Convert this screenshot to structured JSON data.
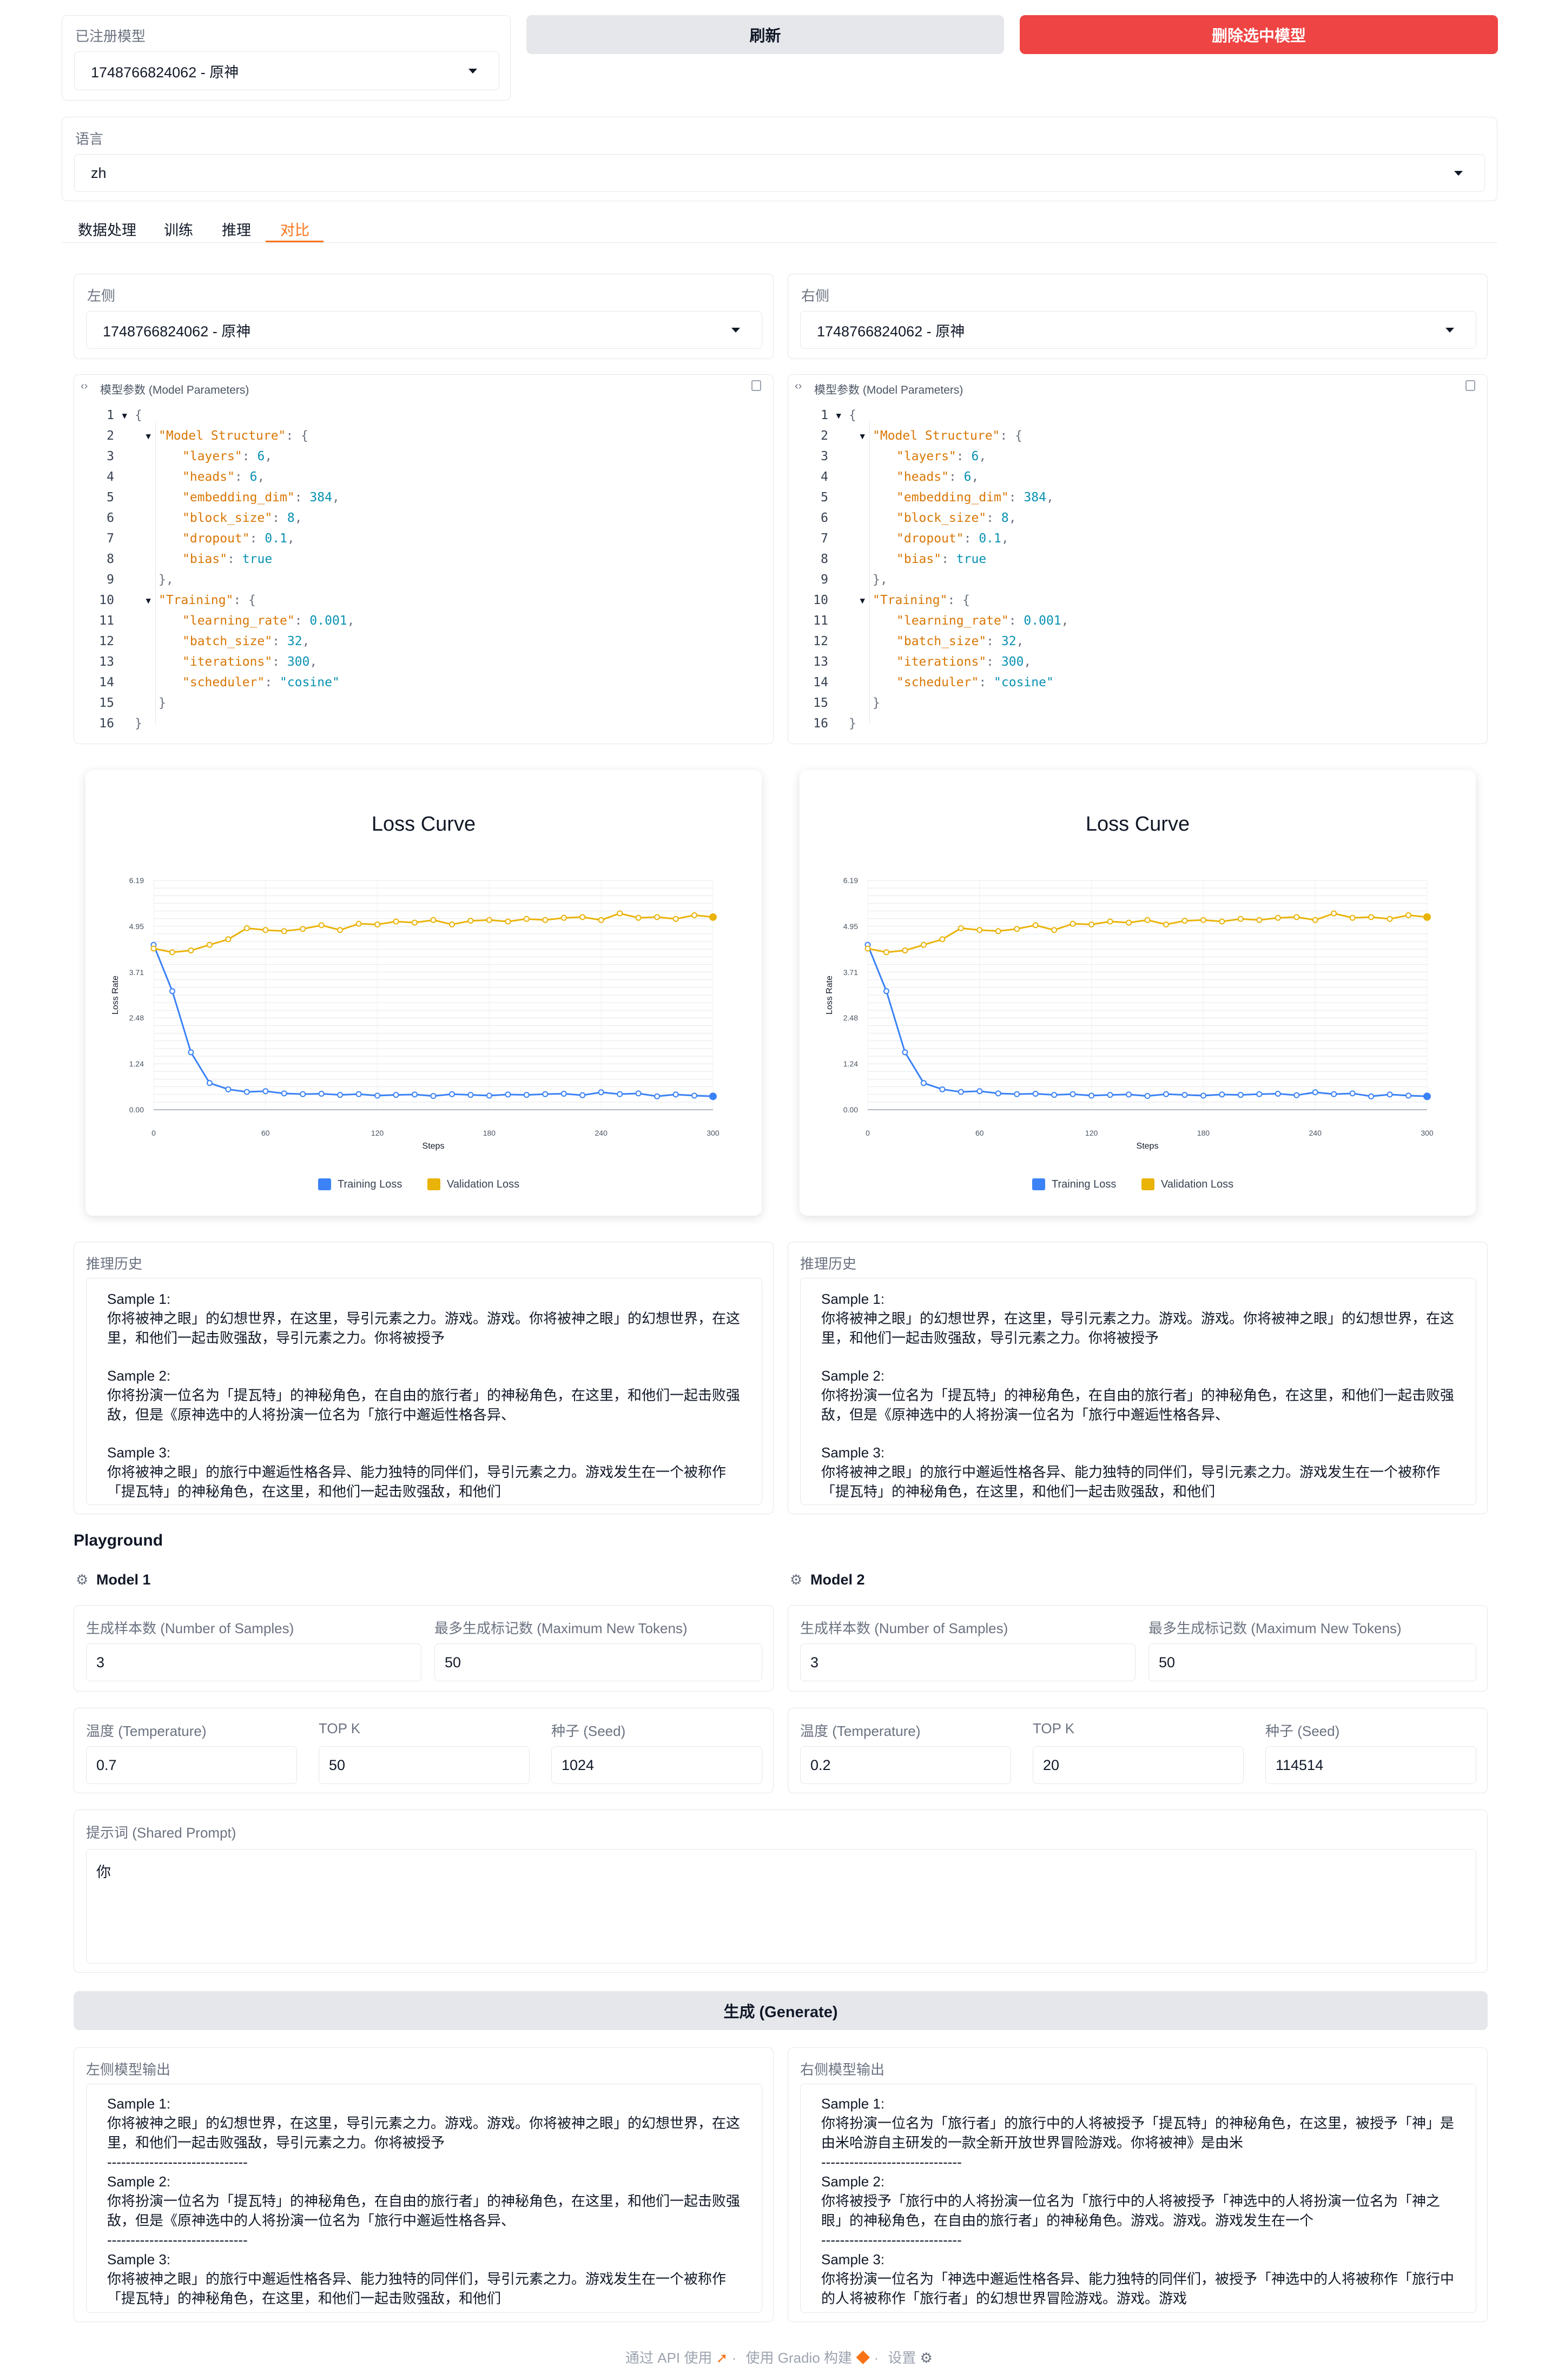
{
  "top": {
    "registered_models_label": "已注册模型",
    "registered_model_value": "1748766824062 - 原神",
    "refresh_label": "刷新",
    "delete_label": "删除选中模型",
    "delete_color": "#ef4444",
    "language_label": "语言",
    "language_value": "zh"
  },
  "tabs": [
    "数据处理",
    "训练",
    "推理",
    "对比"
  ],
  "active_tab": "对比",
  "accent_color": "#f97316",
  "compare": {
    "left_label": "左侧",
    "right_label": "右侧",
    "left_model": "1748766824062 - 原神",
    "right_model": "1748766824062 - 原神",
    "params_label": "模型参数 (Model Parameters)",
    "json_lines": [
      "{",
      "\"Model Structure\": {",
      "\"layers\": 6,",
      "\"heads\": 6,",
      "\"embedding_dim\": 384,",
      "\"block_size\": 8,",
      "\"dropout\": 0.1,",
      "\"bias\": true",
      "},",
      "\"Training\": {",
      "\"learning_rate\": 0.001,",
      "\"batch_size\": 32,",
      "\"iterations\": 300,",
      "\"scheduler\": \"cosine\"",
      "}",
      "}"
    ],
    "line_numbers": [
      "1",
      "2",
      "3",
      "4",
      "5",
      "6",
      "7",
      "8",
      "9",
      "10",
      "11",
      "12",
      "13",
      "14",
      "15",
      "16"
    ]
  },
  "chart_data": [
    {
      "type": "line",
      "title": "Loss Curve",
      "xlabel": "Steps",
      "ylabel": "Loss Rate",
      "xlim": [
        0,
        300
      ],
      "ylim": [
        0,
        6.19
      ],
      "x_ticks": [
        "0",
        "60",
        "120",
        "180",
        "240",
        "300"
      ],
      "y_ticks": [
        "0.00",
        "1.24",
        "2.48",
        "3.71",
        "4.95",
        "6.19"
      ],
      "grid": true,
      "legend_position": "bottom",
      "x": [
        0,
        10,
        20,
        30,
        40,
        50,
        60,
        70,
        80,
        90,
        100,
        110,
        120,
        130,
        140,
        150,
        160,
        170,
        180,
        190,
        200,
        210,
        220,
        230,
        240,
        250,
        260,
        270,
        280,
        290,
        300
      ],
      "series": [
        {
          "name": "Training Loss",
          "color": "#3b82f6",
          "values": [
            4.45,
            3.2,
            1.55,
            0.72,
            0.55,
            0.48,
            0.5,
            0.44,
            0.42,
            0.43,
            0.4,
            0.42,
            0.38,
            0.4,
            0.41,
            0.37,
            0.42,
            0.4,
            0.38,
            0.41,
            0.4,
            0.42,
            0.43,
            0.39,
            0.47,
            0.42,
            0.44,
            0.36,
            0.41,
            0.38,
            0.36
          ]
        },
        {
          "name": "Validation Loss",
          "color": "#eab308",
          "values": [
            4.35,
            4.25,
            4.3,
            4.45,
            4.6,
            4.9,
            4.85,
            4.82,
            4.88,
            4.98,
            4.85,
            5.02,
            5.0,
            5.08,
            5.05,
            5.12,
            5.0,
            5.1,
            5.12,
            5.08,
            5.15,
            5.12,
            5.18,
            5.2,
            5.12,
            5.3,
            5.18,
            5.2,
            5.15,
            5.25,
            5.2
          ]
        }
      ]
    },
    {
      "type": "line",
      "title": "Loss Curve",
      "xlabel": "Steps",
      "ylabel": "Loss Rate",
      "xlim": [
        0,
        300
      ],
      "ylim": [
        0,
        6.19
      ],
      "x_ticks": [
        "0",
        "60",
        "120",
        "180",
        "240",
        "300"
      ],
      "y_ticks": [
        "0.00",
        "1.24",
        "2.48",
        "3.71",
        "4.95",
        "6.19"
      ],
      "grid": true,
      "legend_position": "bottom",
      "x": [
        0,
        10,
        20,
        30,
        40,
        50,
        60,
        70,
        80,
        90,
        100,
        110,
        120,
        130,
        140,
        150,
        160,
        170,
        180,
        190,
        200,
        210,
        220,
        230,
        240,
        250,
        260,
        270,
        280,
        290,
        300
      ],
      "series": [
        {
          "name": "Training Loss",
          "color": "#3b82f6",
          "values": [
            4.45,
            3.2,
            1.55,
            0.72,
            0.55,
            0.48,
            0.5,
            0.44,
            0.42,
            0.43,
            0.4,
            0.42,
            0.38,
            0.4,
            0.41,
            0.37,
            0.42,
            0.4,
            0.38,
            0.41,
            0.4,
            0.42,
            0.43,
            0.39,
            0.47,
            0.42,
            0.44,
            0.36,
            0.41,
            0.38,
            0.36
          ]
        },
        {
          "name": "Validation Loss",
          "color": "#eab308",
          "values": [
            4.35,
            4.25,
            4.3,
            4.45,
            4.6,
            4.9,
            4.85,
            4.82,
            4.88,
            4.98,
            4.85,
            5.02,
            5.0,
            5.08,
            5.05,
            5.12,
            5.0,
            5.1,
            5.12,
            5.08,
            5.15,
            5.12,
            5.18,
            5.2,
            5.12,
            5.3,
            5.18,
            5.2,
            5.15,
            5.25,
            5.2
          ]
        }
      ]
    }
  ],
  "history": {
    "label": "推理历史",
    "left": [
      {
        "title": "Sample 1:",
        "text": "你将被神之眼」的幻想世界，在这里，导引元素之力。游戏。游戏。你将被神之眼」的幻想世界，在这里，和他们一起击败强敌，导引元素之力。你将被授予"
      },
      {
        "title": "Sample 2:",
        "text": "你将扮演一位名为「提瓦特」的神秘角色，在自由的旅行者」的神秘角色，在这里，和他们一起击败强敌，但是《原神选中的人将扮演一位名为「旅行中邂逅性格各异、"
      },
      {
        "title": "Sample 3:",
        "text": "你将被神之眼」的旅行中邂逅性格各异、能力独特的同伴们，导引元素之力。游戏发生在一个被称作「提瓦特」的神秘角色，在这里，和他们一起击败强敌，和他们"
      }
    ],
    "right": [
      {
        "title": "Sample 1:",
        "text": "你将被神之眼」的幻想世界，在这里，导引元素之力。游戏。游戏。你将被神之眼」的幻想世界，在这里，和他们一起击败强敌，导引元素之力。你将被授予"
      },
      {
        "title": "Sample 2:",
        "text": "你将扮演一位名为「提瓦特」的神秘角色，在自由的旅行者」的神秘角色，在这里，和他们一起击败强敌，但是《原神选中的人将扮演一位名为「旅行中邂逅性格各异、"
      },
      {
        "title": "Sample 3:",
        "text": "你将被神之眼」的旅行中邂逅性格各异、能力独特的同伴们，导引元素之力。游戏发生在一个被称作「提瓦特」的神秘角色，在这里，和他们一起击败强敌，和他们"
      }
    ]
  },
  "playground": {
    "title": "Playground",
    "model1": "Model 1",
    "model2": "Model 2",
    "num_samples_label": "生成样本数 (Number of Samples)",
    "max_tokens_label": "最多生成标记数 (Maximum New Tokens)",
    "temperature_label": "温度 (Temperature)",
    "topk_label": "TOP K",
    "seed_label": "种子 (Seed)",
    "m1": {
      "num_samples": "3",
      "max_tokens": "50",
      "temperature": "0.7",
      "topk": "50",
      "seed": "1024"
    },
    "m2": {
      "num_samples": "3",
      "max_tokens": "50",
      "temperature": "0.2",
      "topk": "20",
      "seed": "114514"
    },
    "prompt_label": "提示词 (Shared Prompt)",
    "prompt_value": "你",
    "generate_label": "生成 (Generate)"
  },
  "outputs": {
    "left_label": "左侧模型输出",
    "right_label": "右侧模型输出",
    "separator": "------------------------------",
    "left": [
      {
        "title": "Sample 1:",
        "text": "你将被神之眼」的幻想世界，在这里，导引元素之力。游戏。游戏。你将被神之眼」的幻想世界，在这里，和他们一起击败强敌，导引元素之力。你将被授予"
      },
      {
        "title": "Sample 2:",
        "text": "你将扮演一位名为「提瓦特」的神秘角色，在自由的旅行者」的神秘角色，在这里，和他们一起击败强敌，但是《原神选中的人将扮演一位名为「旅行中邂逅性格各异、"
      },
      {
        "title": "Sample 3:",
        "text": "你将被神之眼」的旅行中邂逅性格各异、能力独特的同伴们，导引元素之力。游戏发生在一个被称作「提瓦特」的神秘角色，在这里，和他们一起击败强敌，和他们"
      }
    ],
    "right": [
      {
        "title": "Sample 1:",
        "text": "你将扮演一位名为「旅行者」的旅行中的人将被授予「提瓦特」的神秘角色，在这里，被授予「神」是由米哈游自主研发的一款全新开放世界冒险游戏。你将被神》是由米"
      },
      {
        "title": "Sample 2:",
        "text": "你将被授予「旅行中的人将扮演一位名为「旅行中的人将被授予「神选中的人将扮演一位名为「神之眼」的神秘角色，在自由的旅行者」的神秘角色。游戏。游戏。游戏发生在一个"
      },
      {
        "title": "Sample 3:",
        "text": "你将扮演一位名为「神选中邂逅性格各异、能力独特的同伴们，被授予「神选中的人将被称作「旅行中的人将被称作「旅行者」的幻想世界冒险游戏。游戏。游戏"
      }
    ]
  },
  "footer": {
    "api": "通过 API 使用",
    "gradio": "使用 Gradio 构建",
    "settings": "设置",
    "dot": "·"
  }
}
